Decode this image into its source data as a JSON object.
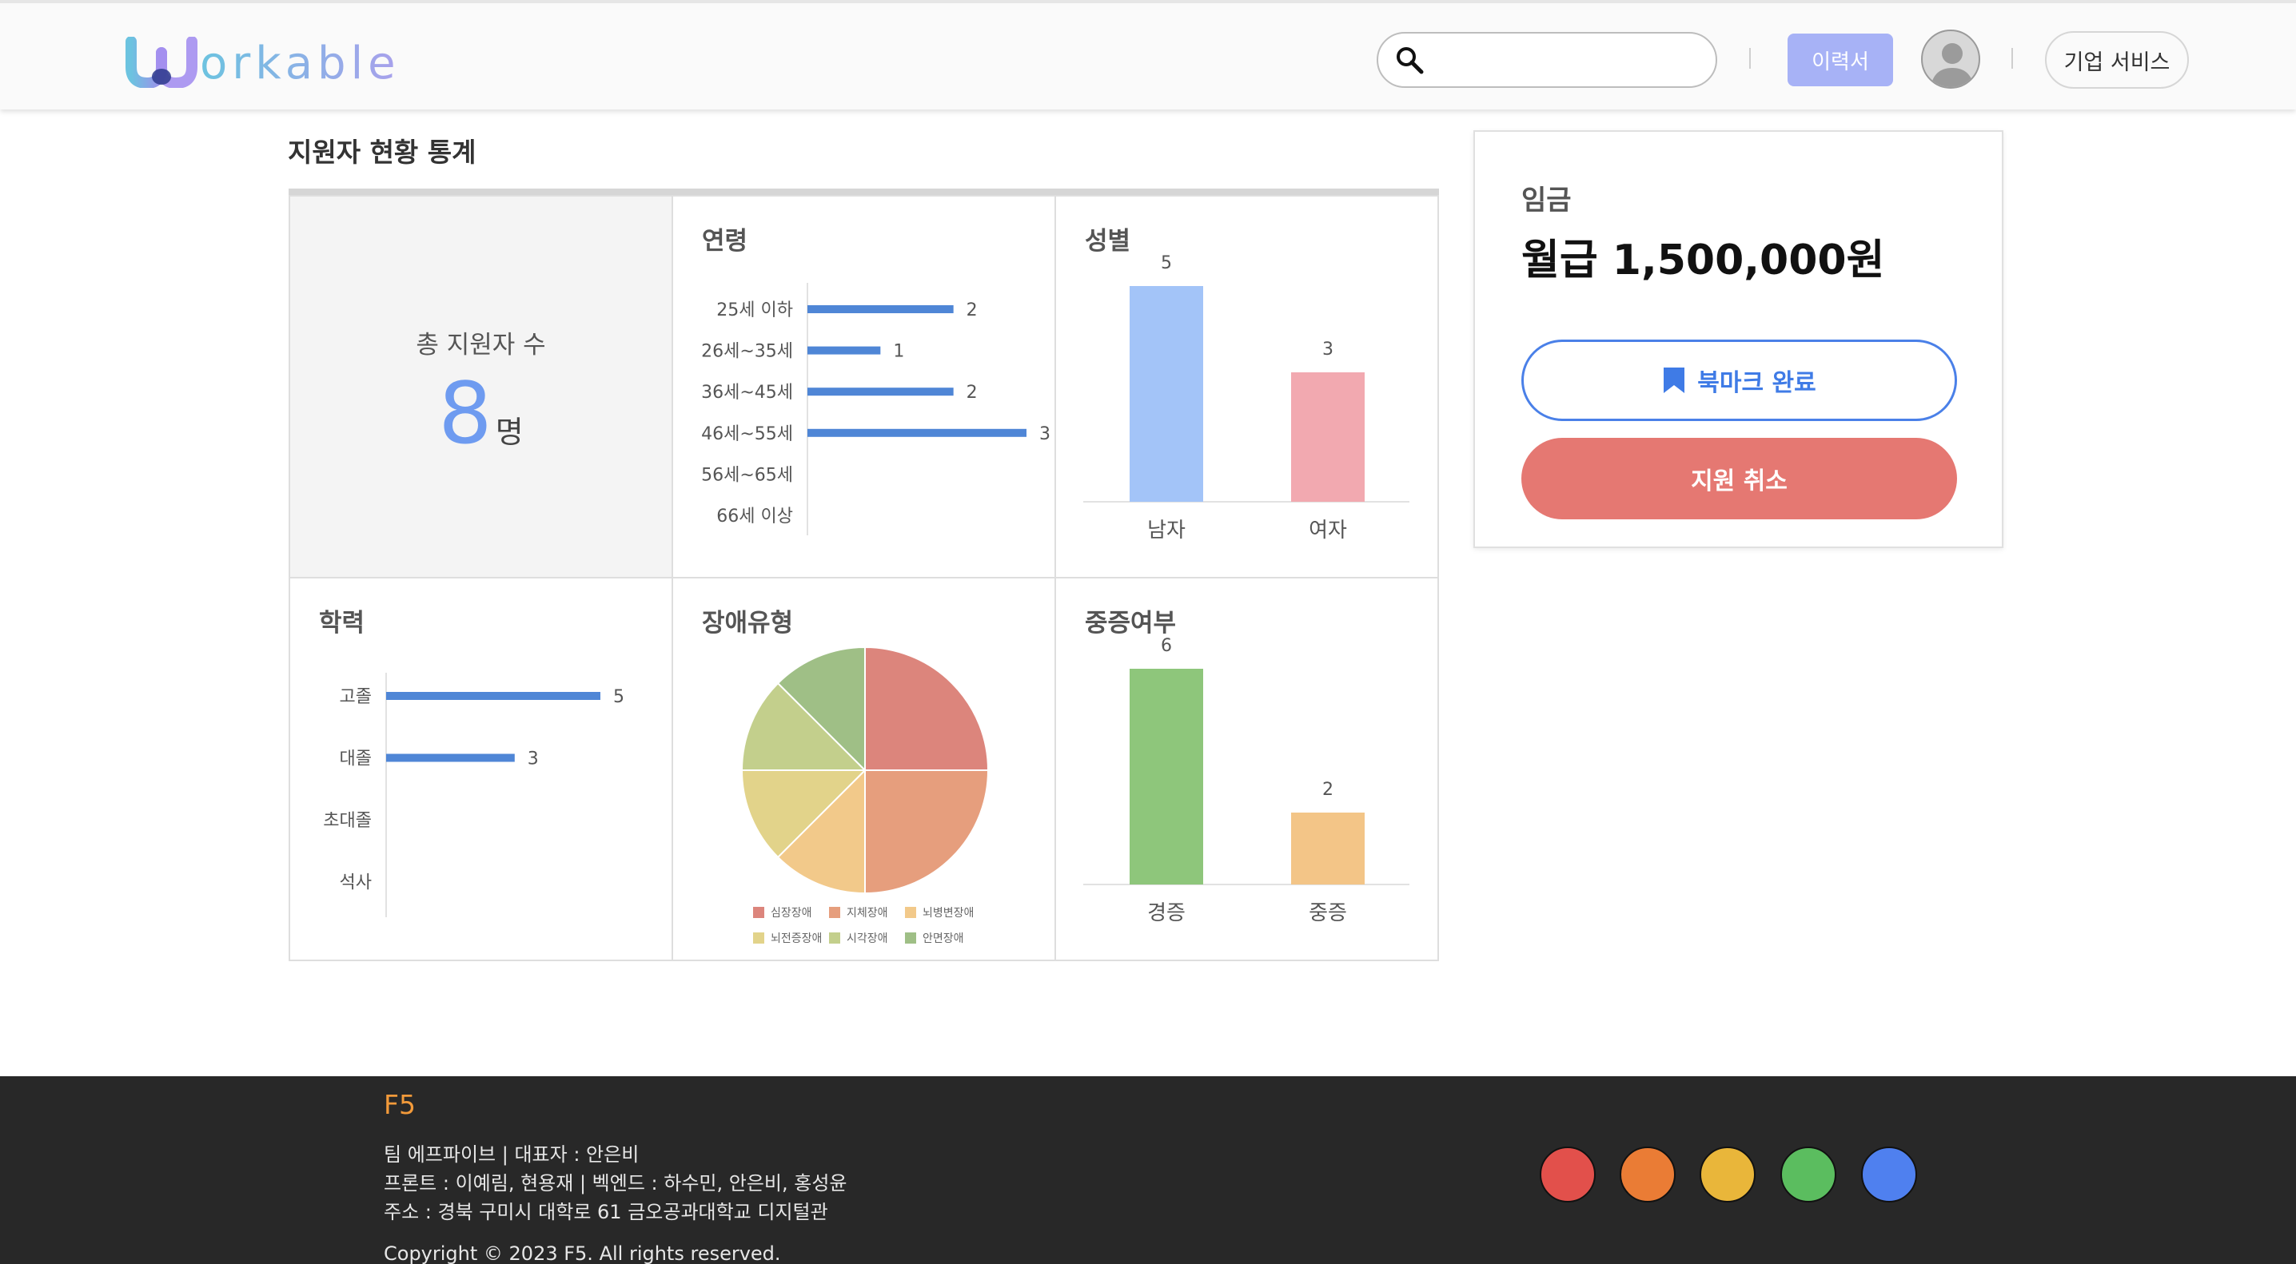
{
  "header": {
    "logo_text": "orkable",
    "logo_initial": "W",
    "search": {
      "placeholder": "",
      "value": ""
    },
    "resume_label": "이력서",
    "corp_service_label": "기업 서비스"
  },
  "stats": {
    "title": "지원자 현황 통계",
    "total": {
      "label": "총 지원자 수",
      "value": "8",
      "unit": "명"
    }
  },
  "chart_data": [
    {
      "type": "bar",
      "orientation": "horizontal",
      "title": "연령",
      "categories": [
        "25세 이하",
        "26세~35세",
        "36세~45세",
        "46세~55세",
        "56세~65세",
        "66세 이상"
      ],
      "values": [
        2,
        1,
        2,
        3,
        0,
        0
      ],
      "data_labels": [
        "2",
        "1",
        "2",
        "3",
        "",
        ""
      ],
      "color": "#4f86d6"
    },
    {
      "type": "bar",
      "title": "성별",
      "categories": [
        "남자",
        "여자"
      ],
      "values": [
        5,
        3
      ],
      "colors": [
        "#a3c4f8",
        "#f2a9b0"
      ]
    },
    {
      "type": "bar",
      "orientation": "horizontal",
      "title": "학력",
      "categories": [
        "고졸",
        "대졸",
        "초대졸",
        "석사"
      ],
      "values": [
        5,
        3,
        0,
        0
      ],
      "data_labels": [
        "5",
        "3",
        "",
        ""
      ],
      "color": "#4f86d6"
    },
    {
      "type": "pie",
      "title": "장애유형",
      "categories": [
        "심장장애",
        "지체장애",
        "뇌병변장애",
        "뇌전증장애",
        "시각장애",
        "안면장애"
      ],
      "values": [
        2,
        2,
        1,
        1,
        1,
        1
      ],
      "colors": [
        "#dc857c",
        "#e69e7d",
        "#f2c98a",
        "#e2d38a",
        "#c3cf8c",
        "#9fbf86"
      ]
    },
    {
      "type": "bar",
      "title": "중증여부",
      "categories": [
        "경증",
        "중증"
      ],
      "values": [
        6,
        2
      ],
      "colors": [
        "#8ec67b",
        "#f3c587"
      ]
    }
  ],
  "wage": {
    "label": "임금",
    "value": "월급 1,500,000원",
    "bookmark_label": "북마크 완료",
    "cancel_label": "지원 취소"
  },
  "footer": {
    "brand": "F5",
    "line1": "팀 에프파이브 | 대표자 : 안은비",
    "line2": "프론트 : 이예림, 현용재 | 벡엔드 : 하수민, 안은비, 홍성윤",
    "line3": "주소 : 경북 구미시 대학로 61 금오공과대학교 디지털관",
    "copyright": "Copyright © 2023 F5. All rights reserved.",
    "dot_colors": [
      "#e2504b",
      "#ea7c35",
      "#e9b63a",
      "#5bbd5f",
      "#4f80ef"
    ]
  }
}
